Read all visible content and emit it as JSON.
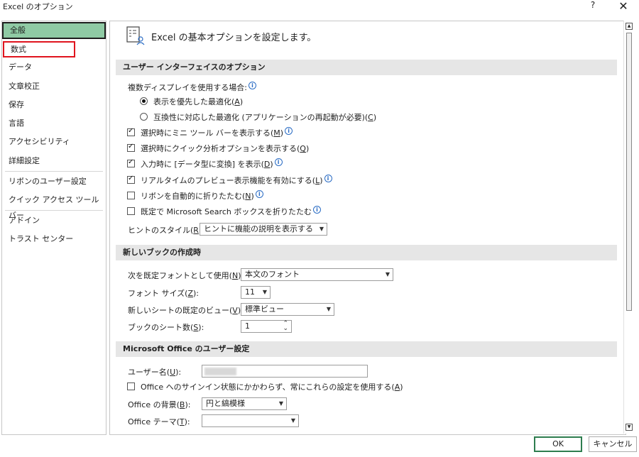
{
  "window": {
    "title": "Excel のオプション",
    "help": "?",
    "close": "✕"
  },
  "sidebar": {
    "items": [
      {
        "label": "全般"
      },
      {
        "label": "数式"
      },
      {
        "label": "データ"
      },
      {
        "label": "文章校正"
      },
      {
        "label": "保存"
      },
      {
        "label": "言語"
      },
      {
        "label": "アクセシビリティ"
      },
      {
        "label": "詳細設定"
      },
      {
        "label": "リボンのユーザー設定"
      },
      {
        "label": "クイック アクセス ツール バー"
      },
      {
        "label": "アドイン"
      },
      {
        "label": "トラスト センター"
      }
    ]
  },
  "header": {
    "title": "Excel の基本オプションを設定します。"
  },
  "ui_section": {
    "title": "ユーザー インターフェイスのオプション",
    "multi_display_label": "複数ディスプレイを使用する場合:",
    "radio1": {
      "pre": "表示を優先した最適化(",
      "key": "A",
      "post": ")"
    },
    "radio2": {
      "pre": "互換性に対応した最適化 (アプリケーションの再起動が必要)(",
      "key": "C",
      "post": ")"
    },
    "cb_mini": {
      "pre": "選択時にミニ ツール バーを表示する(",
      "key": "M",
      "post": ")"
    },
    "cb_quick": {
      "pre": "選択時にクイック分析オプションを表示する(",
      "key": "Q",
      "post": ")"
    },
    "cb_convert": {
      "pre": "入力時に [データ型に変換] を表示(",
      "key": "D",
      "post": ")"
    },
    "cb_preview": {
      "pre": "リアルタイムのプレビュー表示機能を有効にする(",
      "key": "L",
      "post": ")"
    },
    "cb_collapse": {
      "pre": "リボンを自動的に折りたたむ(",
      "key": "N",
      "post": ")"
    },
    "cb_search": {
      "text": "既定で Microsoft Search ボックスを折りたたむ"
    },
    "tooltip_label": {
      "pre": "ヒントのスタイル(",
      "key": "R",
      "post": "):"
    },
    "tooltip_value": "ヒントに機能の説明を表示する"
  },
  "workbook_section": {
    "title": "新しいブックの作成時",
    "font_label": {
      "pre": "次を既定フォントとして使用(",
      "key": "N",
      "post": "):"
    },
    "font_value": "本文のフォント",
    "size_label": {
      "pre": "フォント サイズ(",
      "key": "Z",
      "post": "):"
    },
    "size_value": "11",
    "view_label": {
      "pre": "新しいシートの既定のビュー(",
      "key": "V",
      "post": "):"
    },
    "view_value": "標準ビュー",
    "sheets_label": {
      "pre": "ブックのシート数(",
      "key": "S",
      "post": "):"
    },
    "sheets_value": "1"
  },
  "office_section": {
    "title": "Microsoft Office のユーザー設定",
    "username_label": {
      "pre": "ユーザー名(",
      "key": "U",
      "post": "):"
    },
    "always_use": {
      "pre": "Office へのサインイン状態にかかわらず、常にこれらの設定を使用する(",
      "key": "A",
      "post": ")"
    },
    "background_label": {
      "pre": "Office の背景(",
      "key": "B",
      "post": "):"
    },
    "background_value": "円と縞模様",
    "theme_label": {
      "pre": "Office テーマ(",
      "key": "T",
      "post": "):"
    },
    "theme_value": ""
  },
  "buttons": {
    "ok": "OK",
    "cancel": "キャンセル"
  },
  "colors": {
    "selected_bg": "#8fcaa4",
    "highlight_border": "#e0141e",
    "section_bg": "#e6e6e6",
    "info_blue": "#2a6cc4"
  }
}
